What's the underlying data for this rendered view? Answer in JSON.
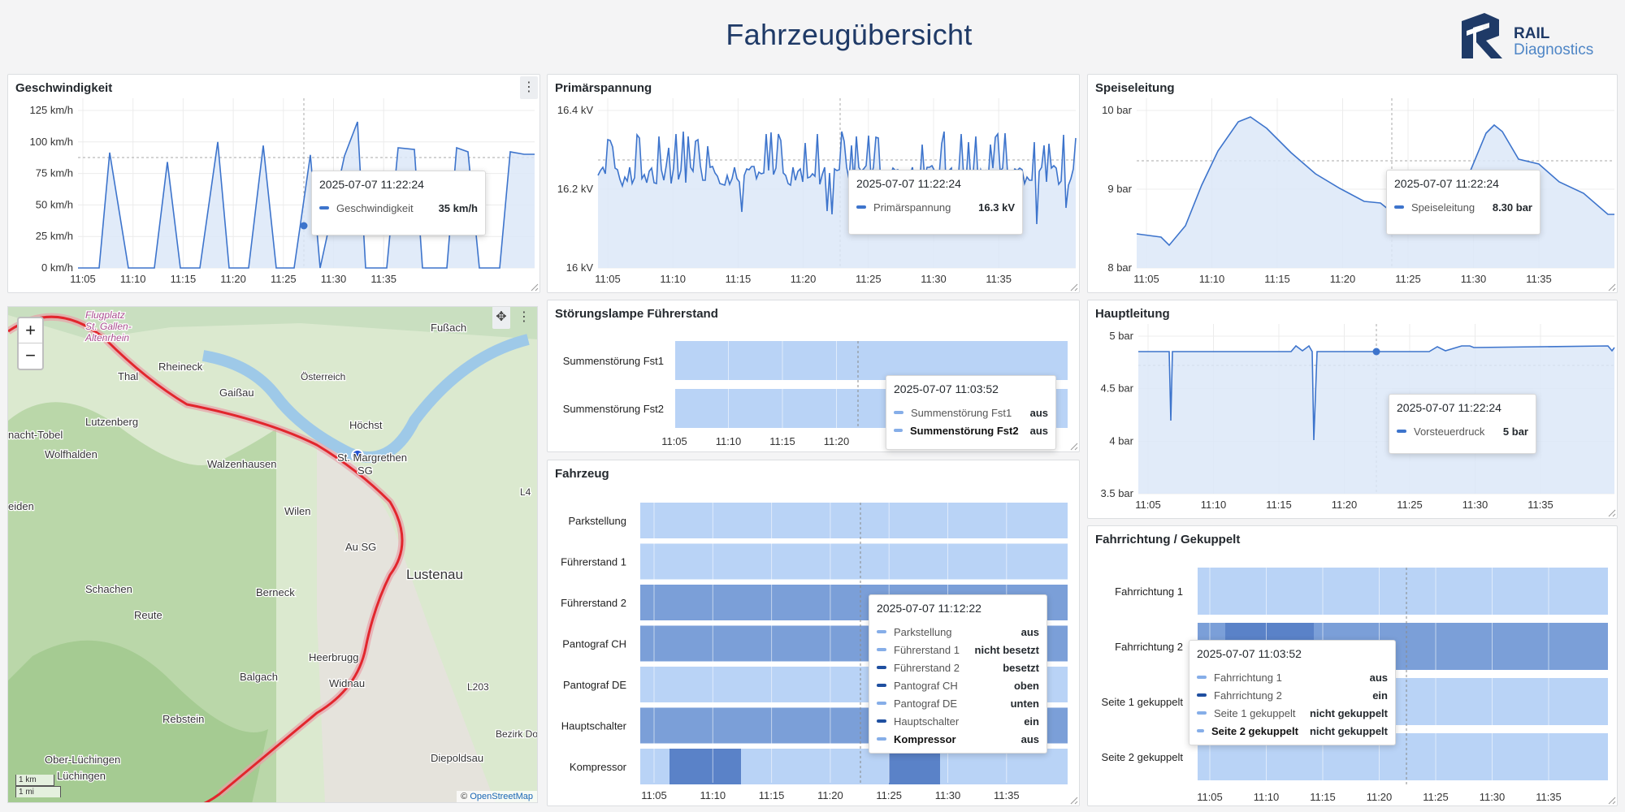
{
  "header": {
    "title": "Fahrzeugübersicht",
    "logo_line1": "RAIL",
    "logo_line2": "Diagnostics"
  },
  "colors": {
    "line": "#3d74cc",
    "fill": "#dce8f8",
    "state_light": "#b9d3f6",
    "state_dark": "#7b9fd8",
    "state_darker": "#5a82c8",
    "brand": "#1f3a67"
  },
  "icons": {
    "menu": "kebab-menu-icon",
    "move": "move-icon",
    "zoom_in": "plus-icon",
    "zoom_out": "minus-icon"
  },
  "xaxis": {
    "ticks": [
      "11:05",
      "11:10",
      "11:15",
      "11:20",
      "11:25",
      "11:30",
      "11:35"
    ]
  },
  "panels": {
    "speed": {
      "title": "Geschwindigkeit",
      "menu": "⋮",
      "yticks": [
        "125 km/h",
        "100 km/h",
        "75 km/h",
        "50 km/h",
        "25 km/h",
        "0 km/h"
      ],
      "tooltip": {
        "time": "2025-07-07 11:22:24",
        "rows": [
          {
            "label": "Geschwindigkeit",
            "value": "35 km/h"
          }
        ]
      }
    },
    "voltage": {
      "title": "Primärspannung",
      "yticks": [
        "16.4 kV",
        "16.2 kV",
        "16 kV"
      ],
      "tooltip": {
        "time": "2025-07-07 11:22:24",
        "rows": [
          {
            "label": "Primärspannung",
            "value": "16.3 kV"
          }
        ]
      }
    },
    "feed": {
      "title": "Speiseleitung",
      "yticks": [
        "10 bar",
        "9 bar",
        "8 bar"
      ],
      "tooltip": {
        "time": "2025-07-07 11:22:24",
        "rows": [
          {
            "label": "Speiseleitung",
            "value": "8.30 bar"
          }
        ]
      }
    },
    "fault": {
      "title": "Störungslampe Führerstand",
      "rows": [
        "Summenstörung Fst1",
        "Summenstörung Fst2"
      ],
      "xticks": [
        "11:05",
        "11:10",
        "11:15",
        "11:20"
      ],
      "tooltip": {
        "time": "2025-07-07 11:03:52",
        "rows": [
          {
            "label": "Summenstörung Fst1",
            "value": "aus"
          },
          {
            "label": "Summenstörung Fst2",
            "value": "aus"
          }
        ]
      }
    },
    "main": {
      "title": "Hauptleitung",
      "yticks": [
        "5 bar",
        "4.5 bar",
        "4 bar",
        "3.5 bar"
      ],
      "tooltip": {
        "time": "2025-07-07 11:22:24",
        "rows": [
          {
            "label": "Vorsteuerdruck",
            "value": "5 bar"
          }
        ]
      }
    },
    "vehicle": {
      "title": "Fahrzeug",
      "rows": [
        "Parkstellung",
        "Führerstand 1",
        "Führerstand 2",
        "Pantograf CH",
        "Pantograf DE",
        "Hauptschalter",
        "Kompressor"
      ],
      "tooltip": {
        "time": "2025-07-07 11:12:22",
        "rows": [
          {
            "label": "Parkstellung",
            "value": "aus"
          },
          {
            "label": "Führerstand 1",
            "value": "nicht besetzt"
          },
          {
            "label": "Führerstand 2",
            "value": "besetzt"
          },
          {
            "label": "Pantograf CH",
            "value": "oben"
          },
          {
            "label": "Pantograf DE",
            "value": "unten"
          },
          {
            "label": "Hauptschalter",
            "value": "ein"
          },
          {
            "label": "Kompressor",
            "value": "aus"
          }
        ]
      }
    },
    "direction": {
      "title": "Fahrrichtung / Gekuppelt",
      "rows": [
        "Fahrrichtung 1",
        "Fahrrichtung 2",
        "Seite 1 gekuppelt",
        "Seite 2 gekuppelt"
      ],
      "tooltip": {
        "time": "2025-07-07 11:03:52",
        "rows": [
          {
            "label": "Fahrrichtung 1",
            "value": "aus"
          },
          {
            "label": "Fahrrichtung 2",
            "value": "ein"
          },
          {
            "label": "Seite 1 gekuppelt",
            "value": "nicht gekuppelt"
          },
          {
            "label": "Seite 2 gekuppelt",
            "value": "nicht gekuppelt"
          }
        ]
      }
    }
  },
  "map": {
    "zoom_in": "+",
    "zoom_out": "−",
    "scale_km": "1 km",
    "scale_mi": "1 mi",
    "attribution_prefix": "© ",
    "attribution_link": "OpenStreetMap",
    "labels": [
      "Flugplatz",
      "St. Gallen-",
      "Altenrhein",
      "Fußach",
      "Thal",
      "Rheineck",
      "Gaißau",
      "nacht-Tobel",
      "Lutzenberg",
      "Höchst",
      "Wolfhalden",
      "Walzenhausen",
      "St. Margrethen",
      "SG",
      "eiden",
      "Wilen",
      "Au SG",
      "Lustenau",
      "Schachen",
      "Berneck",
      "Reute",
      "Heerbrugg",
      "Balgach",
      "Widnau",
      "Rebstein",
      "Ober-Lüchingen",
      "Lüchingen",
      "Diepoldsau",
      "L203",
      "L4",
      "Bezirk Dornbirn",
      "Österreich"
    ]
  }
}
